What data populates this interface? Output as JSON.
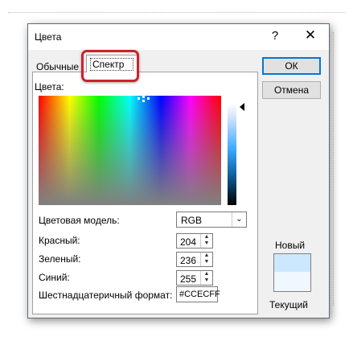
{
  "dialog": {
    "title": "Цвета",
    "help": "?",
    "close": "✕"
  },
  "tabs": [
    {
      "label": "Обычные",
      "selected": false
    },
    {
      "label": "Спектр",
      "selected": true
    }
  ],
  "panel": {
    "colors_label": "Цвета:",
    "color_model_label": "Цветовая модель:",
    "color_model_value": "RGB",
    "red_label": "Красный:",
    "red_value": "204",
    "green_label": "Зеленый:",
    "green_value": "236",
    "blue_label": "Синий:",
    "blue_value": "255",
    "hex_label": "Шестнадцатеричный формат:",
    "hex_value": "#CCECFF"
  },
  "buttons": {
    "ok": "ОК",
    "cancel": "Отмена"
  },
  "preview": {
    "new_label": "Новый",
    "current_label": "Текущий",
    "new_color": "#cce8ff",
    "current_color": "#f0f7ff"
  },
  "colors": {
    "highlight": "#d0202a",
    "ok_border": "#0078d7"
  }
}
